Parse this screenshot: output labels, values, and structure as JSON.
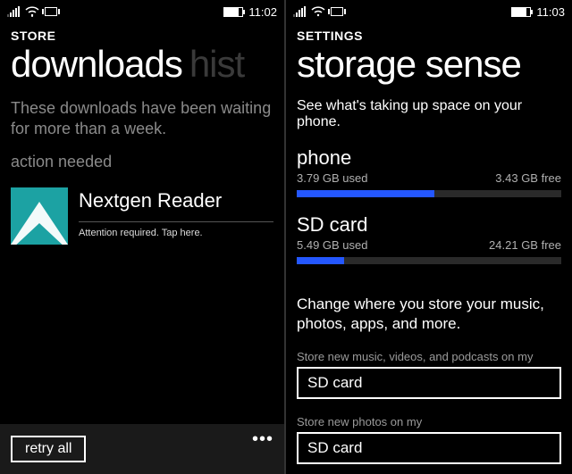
{
  "left": {
    "statusbar": {
      "time": "11:02"
    },
    "header": "STORE",
    "pivot_active": "downloads",
    "pivot_next": "hist",
    "waiting_msg": "These downloads have been waiting for more than a week.",
    "action_needed": "action needed",
    "app": {
      "name": "Nextgen Reader",
      "status": "Attention required. Tap here."
    },
    "retry_label": "retry all"
  },
  "right": {
    "statusbar": {
      "time": "11:03"
    },
    "header": "SETTINGS",
    "title": "storage sense",
    "description": "See what's taking up space on your phone.",
    "storage": [
      {
        "name": "phone",
        "used": "3.79 GB used",
        "free": "3.43 GB free",
        "fill_pct": 52
      },
      {
        "name": "SD card",
        "used": "5.49 GB used",
        "free": "24.21 GB free",
        "fill_pct": 18
      }
    ],
    "change_msg": "Change where you store your music, photos, apps, and more.",
    "field1_label": "Store new music, videos, and podcasts on my",
    "field1_value": "SD card",
    "field2_label": "Store new photos on my",
    "field2_value": "SD card"
  }
}
